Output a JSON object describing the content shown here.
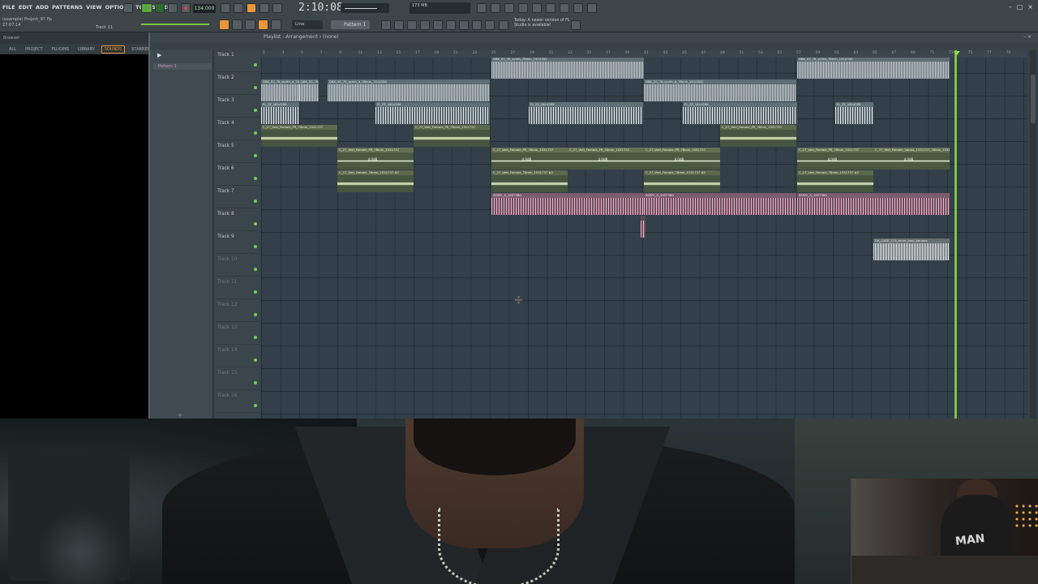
{
  "menu": [
    "FILE",
    "EDIT",
    "ADD",
    "PATTERNS",
    "VIEW",
    "OPTIONS",
    "TOOLS",
    "HELP"
  ],
  "project": {
    "file": "(example) Project_97.flp",
    "time": "27:07:14",
    "track_hint": "Track 11"
  },
  "transport": {
    "bpm": "134.000",
    "time_display": "2:10:08",
    "cpu_mem": "173 MB"
  },
  "toolbar": {
    "snap": "Line",
    "pattern": "Pattern 1",
    "news": "Today: A newer version of FL Studio is available!"
  },
  "browser": {
    "title": "Browser",
    "tabs": [
      "ALL",
      "PROJECT",
      "PLUGINS",
      "LIBRARY",
      "SOUNDS",
      "STARRED"
    ],
    "active_tab": "SOUNDS"
  },
  "playlist": {
    "title": "Playlist - Arrangement › (none)",
    "pattern_item": "Pattern 1",
    "ruler": [
      "1",
      "3",
      "5",
      "7",
      "9",
      "11",
      "13",
      "15",
      "17",
      "19",
      "21",
      "23",
      "25",
      "27",
      "29",
      "31",
      "33",
      "35",
      "37",
      "39",
      "41",
      "43",
      "45",
      "47",
      "49",
      "51",
      "53",
      "55",
      "57",
      "59",
      "61",
      "63",
      "65",
      "67",
      "69",
      "71",
      "73",
      "75",
      "77",
      "79"
    ],
    "tracks": [
      "Track 1",
      "Track 2",
      "Track 3",
      "Track 4",
      "Track 5",
      "Track 6",
      "Track 7",
      "Track 8",
      "Track 9",
      "Track 10",
      "Track 11",
      "Track 12",
      "Track 13",
      "Track 14",
      "Track 15",
      "Track 16"
    ],
    "clip_labels": {
      "synth1": "DBK_SS_76_synth_78min_1914300",
      "synth2": "DBK_SS_76_synth_d_78min_1914300",
      "fl1": "FL_SF_1814299",
      "vox1": "C_27_Vert_Female_PR_78min_1531737",
      "vox2": "C_27_Vert_Female_78min_1531737 #2",
      "pink": "SSSPL_S_1557380",
      "vox_last": "C_37_Vert_Female_Vocals_1531737_78min_1531737",
      "drums": "DX_CASE_115_drum_loop_banana",
      "tag": "4.0dB"
    }
  },
  "webcam": {
    "shirt_text": "MAN"
  },
  "colors": {
    "playhead": "#86d43c",
    "accent": "#e8973b",
    "clip_pink": "#e8b4cc"
  }
}
